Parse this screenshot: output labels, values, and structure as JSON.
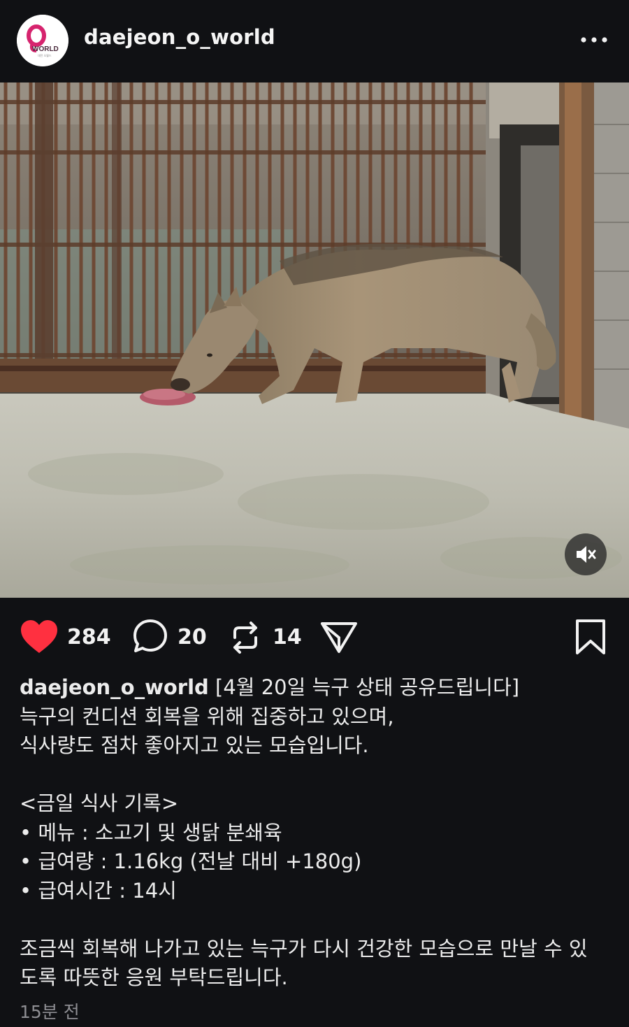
{
  "header": {
    "avatar_logo_text": "WORLD",
    "username": "daejeon_o_world",
    "more_icon": "more-horizontal-icon"
  },
  "media": {
    "description_icon": "video",
    "mute_icon": "speaker-muted-icon"
  },
  "actions": {
    "like": {
      "icon": "heart-filled-icon",
      "count": "284",
      "color": "#ff3040"
    },
    "comment": {
      "icon": "comment-bubble-icon",
      "count": "20"
    },
    "repost": {
      "icon": "repost-icon",
      "count": "14"
    },
    "share": {
      "icon": "send-icon"
    },
    "save": {
      "icon": "bookmark-icon"
    }
  },
  "caption": {
    "username": "daejeon_o_world",
    "first_line_rest": " [4월 20일 늑구 상태 공유드립니다]",
    "lines": [
      "늑구의 컨디션 회복을 위해 집중하고 있으며,",
      "식사량도 점차 좋아지고 있는 모습입니다.",
      "",
      "<금일 식사 기록>",
      "• 메뉴 : 소고기 및 생닭 분쇄육",
      "• 급여량 : 1.16kg (전날 대비 +180g)",
      "• 급여시간 : 14시",
      "",
      "조금씩 회복해 나가고 있는 늑구가 다시 건강한 모습으로 만날 수 있",
      "도록 따뜻한 응원 부탁드립니다."
    ]
  },
  "timestamp": "15분 전"
}
